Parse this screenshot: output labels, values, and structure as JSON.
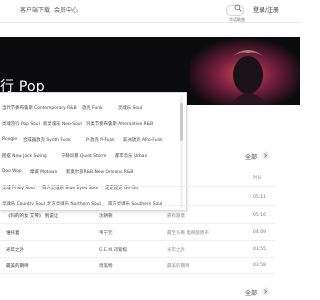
{
  "nav": {
    "items": [
      "客户端下载",
      "会员中心"
    ],
    "search_placeholder": "华语歌曲",
    "login": "登录/注册"
  },
  "hero": {
    "title": "行 Pop"
  },
  "dropdown": {
    "tags": [
      [
        "当代节奏布鲁斯 Contemporary R&B",
        "放克 Funk",
        "灵魂乐 Soul"
      ],
      [
        "灵魂流行 Pop Soul",
        "新灵魂乐 Neo-Soul",
        "另类节奏布鲁斯 Alternative R&B"
      ],
      [
        "Boogie",
        "合成器放克 Synth Funk",
        "P-放克 P-Funk",
        "非洲放克 Afro-Funk"
      ],
      [
        "摇摆 New Jack Swing",
        "宁静风暴 Quiet Storm",
        "都市音乐 Urban"
      ],
      [
        "Doo Wop",
        "摩城 Motown",
        "新奥尔良R&B New Orleans R&B"
      ],
      [
        "灵魂 Philly Soul",
        "白人灵魂乐 Blue Eyed Soul",
        "走走放克 Go-Go"
      ],
      [
        "灵魂乐 Country Soul",
        "北方灵魂乐 Northern Soul",
        "南方灵魂乐 Southern Soul"
      ]
    ]
  },
  "list": {
    "all_label": "全部",
    "time_header": "时长",
    "rows": [
      {
        "title": "",
        "singer": "",
        "album": "",
        "time": "05:11"
      },
      {
        "title": "",
        "singer": "",
        "album": "",
        "time": "05:16"
      },
      {
        "title": "《吗的的女 艾琴》 别说让",
        "singer": "沈朝朝",
        "album": "愿有跟意",
        "time": "03:21"
      },
      {
        "title": "谁托着",
        "singer": "韦宁元",
        "album": "最至头看 电视版原声",
        "time": "04:09"
      },
      {
        "title": "光年之外",
        "singer": "G.E.M.邓紫棋",
        "album": "光年之外",
        "time": "03:55"
      },
      {
        "title": "最美的期待",
        "singer": "周笔畅",
        "album": "最美的期待",
        "time": "03:58"
      }
    ],
    "footer_all": "全部"
  },
  "colors": {
    "hero_bg": "#0b0b0d",
    "accent": "#31c27c"
  },
  "icons": [
    "search-icon",
    "arrow-right-icon"
  ]
}
